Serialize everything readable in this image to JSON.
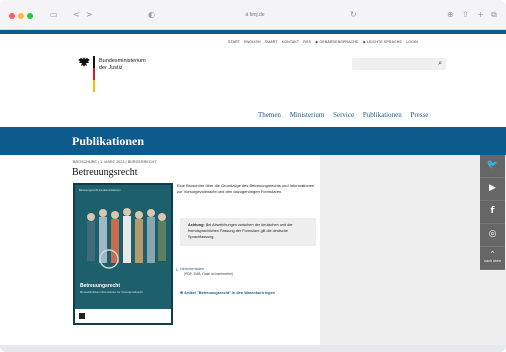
{
  "browser": {
    "url": "ä bmj.de",
    "back_symbol": "<",
    "forward_symbol": ">",
    "sidebar_symbol": "▭",
    "shield_symbol": "◐",
    "reload_symbol": "↻",
    "download_symbol": "⊕",
    "share_symbol": "⇧",
    "newtab_symbol": "+",
    "tabs_symbol": "⧉"
  },
  "meta_nav": {
    "items": [
      "START",
      "ENGLISH",
      "SMART",
      "KONTAKT",
      "RSS",
      "◉ GEBÄRDENSPRACHE",
      "◉ LEICHTE SPRACHE",
      "LOGIN"
    ]
  },
  "logo": {
    "line1": "Bundesministerium",
    "line2": "der Justiz"
  },
  "search": {
    "placeholder": "",
    "icon": "search-icon"
  },
  "main_nav": {
    "items": [
      "Themen",
      "Ministerium",
      "Service",
      "Publikationen",
      "Presse"
    ]
  },
  "band": {
    "title": "Publikationen"
  },
  "publication": {
    "breadcrumb": "BROSCHÜRE | 1. MÄRZ 2023 | BÜRGERRECHT",
    "title": "Betreuungsrecht",
    "description": "Eine Broschüre über die Grundzüge des Betreuungsrechts und Informationen zur Vorsorgevollmacht und den dazugehörigen Formularen.",
    "notice_bold": "Achtung:",
    "notice_text": " Bei Abweichungen zwischen der deutschen und der fremdsprachlichen Fassung der Formulare gilt die deutsche Sprachfassung.",
    "download_label": "Herunterladen",
    "download_meta": "(PDF, 2MB, Datei ist barrierefrei)",
    "cart_label": "⊕ Artikel \"Betreuungsrecht\" in den Warenkorb legen",
    "cover": {
      "top_text": "Betreuungsrecht\nbundesministerium",
      "title": "Betreuungsrecht",
      "subtitle": "Mit ausführlichen Informationen zur Vorsorgevollmacht"
    }
  },
  "social": {
    "buttons": [
      {
        "name": "twitter",
        "glyph": "🐦"
      },
      {
        "name": "youtube",
        "glyph": "▶"
      },
      {
        "name": "facebook",
        "glyph": "f"
      },
      {
        "name": "instagram",
        "glyph": "◎"
      }
    ],
    "top_arrow": "⌃",
    "top_label": "nach oben"
  },
  "colors": {
    "accent": "#0d5a8d",
    "flag_black": "#111111",
    "flag_red": "#d21f1f",
    "flag_gold": "#f2c200"
  }
}
